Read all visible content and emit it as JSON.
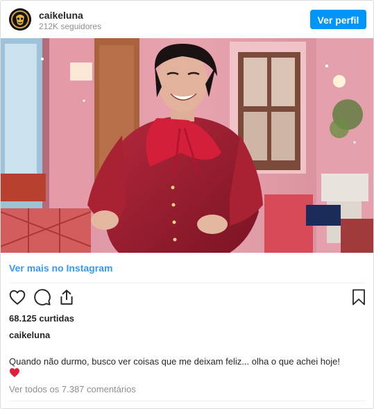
{
  "header": {
    "username": "caikeluna",
    "followers": "212K seguidores",
    "profile_button": "Ver perfil"
  },
  "media": {
    "description_icon": "video-still"
  },
  "view_more": "Ver mais no Instagram",
  "actions": {
    "icons": [
      "heart-icon",
      "comment-icon",
      "share-icon",
      "bookmark-icon"
    ]
  },
  "likes": "68.125 curtidas",
  "caption": {
    "username": "caikeluna",
    "text": "Quando não durmo, busco ver coisas que me deixam feliz... olha o que achei hoje!",
    "emoji": "❤️"
  },
  "comments_link": "Ver todos os 7.387 comentários",
  "colors": {
    "accent": "#0095f6",
    "link": "#3897f0",
    "muted": "#8e8e8e",
    "text": "#262626",
    "border": "#dbdbdb"
  }
}
